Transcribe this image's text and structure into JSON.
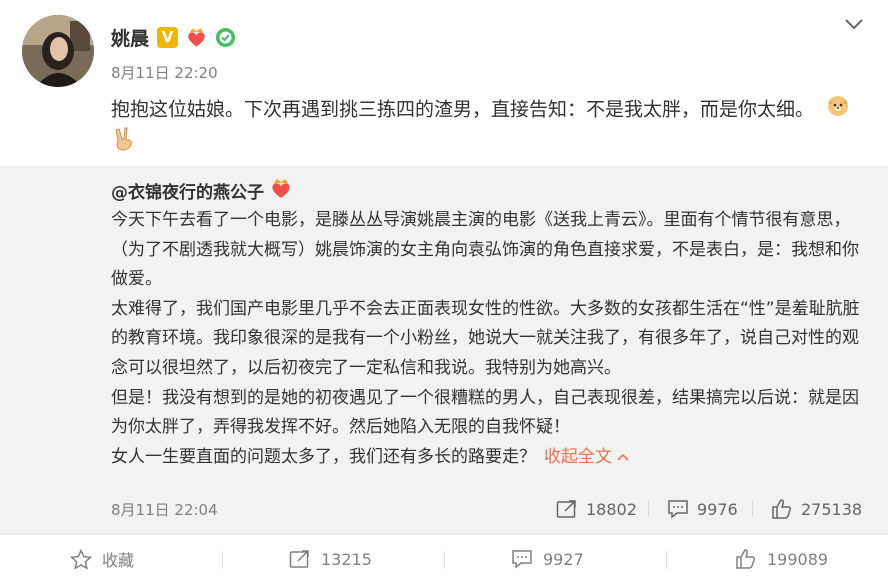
{
  "post": {
    "author_name": "姚晨",
    "time": "8月11日 22:20",
    "text": "抱抱这位姑娘。下次再遇到挑三拣四的渣男，直接告知：不是我太胖，而是你太细。"
  },
  "repost": {
    "author_name": "@衣锦夜行的燕公子",
    "paragraphs": [
      "今天下午去看了一个电影，是滕丛丛导演姚晨主演的电影《送我上青云》。里面有个情节很有意思，（为了不剧透我就大概写）姚晨饰演的女主角向袁弘饰演的角色直接求爱，不是表白，是：我想和你做爱。",
      "太难得了，我们国产电影里几乎不会去正面表现女性的性欲。大多数的女孩都生活在“性”是羞耻肮脏的教育环境。我印象很深的是我有一个小粉丝，她说大一就关注我了，有很多年了，说自己对性的观念可以很坦然了，以后初夜完了一定私信和我说。我特别为她高兴。",
      "但是！我没有想到的是她的初夜遇见了一个很糟糕的男人，自己表现很差，结果搞完以后说：就是因为你太胖了，弄得我发挥不好。然后她陷入无限的自我怀疑！",
      "女人一生要直面的问题太多了，我们还有多长的路要走？"
    ],
    "collapse_label": "收起全文",
    "time": "8月11日 22:04",
    "reposts": "18802",
    "comments": "9976",
    "likes": "275138"
  },
  "toolbar": {
    "favorite_label": "收藏",
    "reposts": "13215",
    "comments": "9927",
    "likes": "199089"
  },
  "colors": {
    "link_orange": "#eb7350",
    "repost_bg": "#f2f2f2",
    "vip_gold": "#f2b600"
  }
}
